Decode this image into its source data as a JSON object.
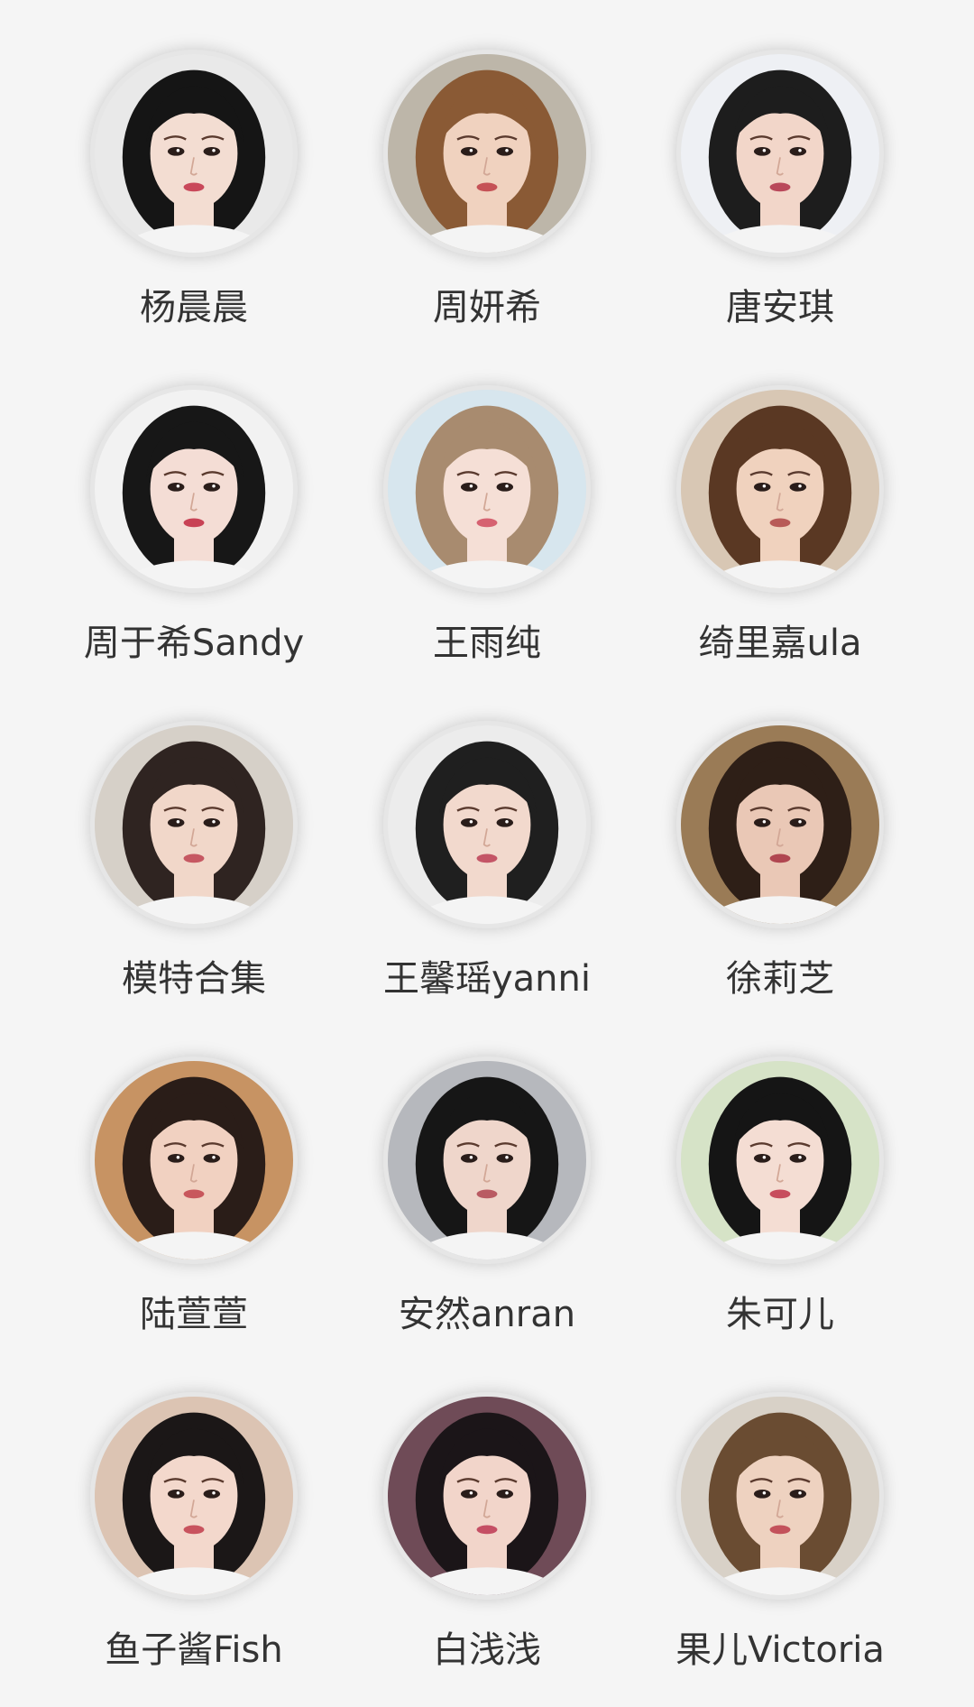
{
  "profiles": [
    {
      "name": "杨晨晨",
      "bg": "#e9e9e9",
      "hair": "#151515",
      "skin": "#f3ddd2",
      "lip": "#c9485a"
    },
    {
      "name": "周妍希",
      "bg": "#bdb6a9",
      "hair": "#8a5a35",
      "skin": "#f0d2bf",
      "lip": "#c55256"
    },
    {
      "name": "唐安琪",
      "bg": "#eef0f4",
      "hair": "#1d1d1d",
      "skin": "#f2d6c9",
      "lip": "#b9485a"
    },
    {
      "name": "周于希Sandy",
      "bg": "#f2f2f2",
      "hair": "#171717",
      "skin": "#f4ddd5",
      "lip": "#c84255"
    },
    {
      "name": "王雨纯",
      "bg": "#d7e6ee",
      "hair": "#a88b6f",
      "skin": "#f5dfd6",
      "lip": "#d66271"
    },
    {
      "name": "绮里嘉ula",
      "bg": "#d8c7b4",
      "hair": "#5a3823",
      "skin": "#f0d2be",
      "lip": "#b85b58"
    },
    {
      "name": "模特合集",
      "bg": "#d6d0c8",
      "hair": "#2f2421",
      "skin": "#f1d7c9",
      "lip": "#c65862"
    },
    {
      "name": "王馨瑶yanni",
      "bg": "#ececec",
      "hair": "#1f1f1f",
      "skin": "#f2d9cd",
      "lip": "#c45566"
    },
    {
      "name": "徐莉芝",
      "bg": "#9a7b56",
      "hair": "#2e1f17",
      "skin": "#eac8b6",
      "lip": "#b04650"
    },
    {
      "name": "陆萱萱",
      "bg": "#c79363",
      "hair": "#2a1d18",
      "skin": "#f1d1c1",
      "lip": "#c8575c"
    },
    {
      "name": "安然anran",
      "bg": "#b6b8bd",
      "hair": "#161616",
      "skin": "#efd6cb",
      "lip": "#b95b63"
    },
    {
      "name": "朱可儿",
      "bg": "#d6e3c7",
      "hair": "#151515",
      "skin": "#f4ddd3",
      "lip": "#c74d5d"
    },
    {
      "name": "鱼子酱Fish",
      "bg": "#dcc4b3",
      "hair": "#1b1717",
      "skin": "#f3d8cc",
      "lip": "#c8535e"
    },
    {
      "name": "白浅浅",
      "bg": "#6f4b57",
      "hair": "#1b1518",
      "skin": "#f2d5ca",
      "lip": "#c54f64"
    },
    {
      "name": "果儿Victoria",
      "bg": "#d8d1c7",
      "hair": "#6a4c32",
      "skin": "#eed2c0",
      "lip": "#c3525b"
    }
  ]
}
